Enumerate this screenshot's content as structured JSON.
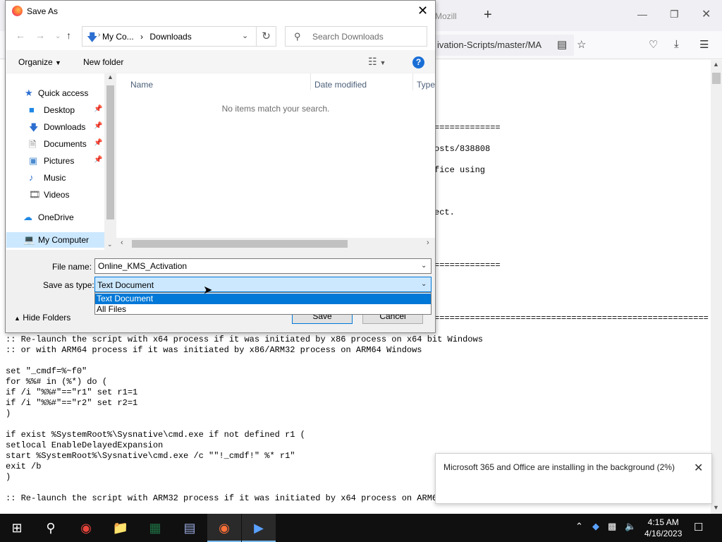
{
  "firefox": {
    "tab_title": "Mozill",
    "new_tab": "+",
    "url_fragment": "ivation-Scripts/master/MA",
    "code_lines": [
      {
        "top": 0,
        "text": ""
      },
      {
        "text": "============="
      },
      {
        "text": "osts/838808"
      },
      {
        "text": "fice using"
      },
      {
        "text": "ect."
      },
      {
        "text": "============="
      },
      {
        "text": "======================================================"
      }
    ],
    "code_full": [
      ":: Re-launch the script with x64 process if it was initiated by x86 process on x64 bit Windows",
      ":: or with ARM64 process if it was initiated by x86/ARM32 process on ARM64 Windows",
      "",
      "set \"_cmdf=%~f0\"",
      "for %%# in (%*) do (",
      "if /i \"%%#\"==\"r1\" set r1=1",
      "if /i \"%%#\"==\"r2\" set r2=1",
      ")",
      "",
      "if exist %SystemRoot%\\Sysnative\\cmd.exe if not defined r1 (",
      "setlocal EnableDelayedExpansion",
      "start %SystemRoot%\\Sysnative\\cmd.exe /c \"\"!_cmdf!\" %* r1\"",
      "exit /b",
      ")",
      "",
      ":: Re-launch the script with ARM32 process if it was initiated by x64 process on ARM64"
    ]
  },
  "notification": {
    "text": "Microsoft 365 and Office are installing in the background (2%)"
  },
  "dialog": {
    "title": "Save As",
    "breadcrumb": {
      "part1": "My Co...",
      "part2": "Downloads"
    },
    "search_placeholder": "Search Downloads",
    "toolbar": {
      "organize": "Organize",
      "new_folder": "New folder"
    },
    "nav_items": [
      {
        "label": "Quick access",
        "icon": "star-icon",
        "pinned": false
      },
      {
        "label": "Desktop",
        "icon": "desktop-icon",
        "pinned": true
      },
      {
        "label": "Downloads",
        "icon": "download-icon",
        "pinned": true
      },
      {
        "label": "Documents",
        "icon": "documents-icon",
        "pinned": true
      },
      {
        "label": "Pictures",
        "icon": "pictures-icon",
        "pinned": true
      },
      {
        "label": "Music",
        "icon": "music-icon",
        "pinned": false
      },
      {
        "label": "Videos",
        "icon": "videos-icon",
        "pinned": false
      },
      {
        "label": "OneDrive",
        "icon": "cloud-icon",
        "pinned": false
      },
      {
        "label": "My Computer",
        "icon": "computer-icon",
        "pinned": false
      }
    ],
    "columns": {
      "name": "Name",
      "date": "Date modified",
      "type": "Type"
    },
    "empty_message": "No items match your search.",
    "file_name_label": "File name:",
    "file_name_value": "Online_KMS_Activation",
    "save_type_label": "Save as type:",
    "save_type_value": "Text Document",
    "save_type_options": [
      "Text Document",
      "All Files"
    ],
    "hide_folders": "Hide Folders",
    "save_button": "Save",
    "cancel_button": "Cancel"
  },
  "taskbar": {
    "time": "4:15 AM",
    "date": "4/16/2023"
  }
}
